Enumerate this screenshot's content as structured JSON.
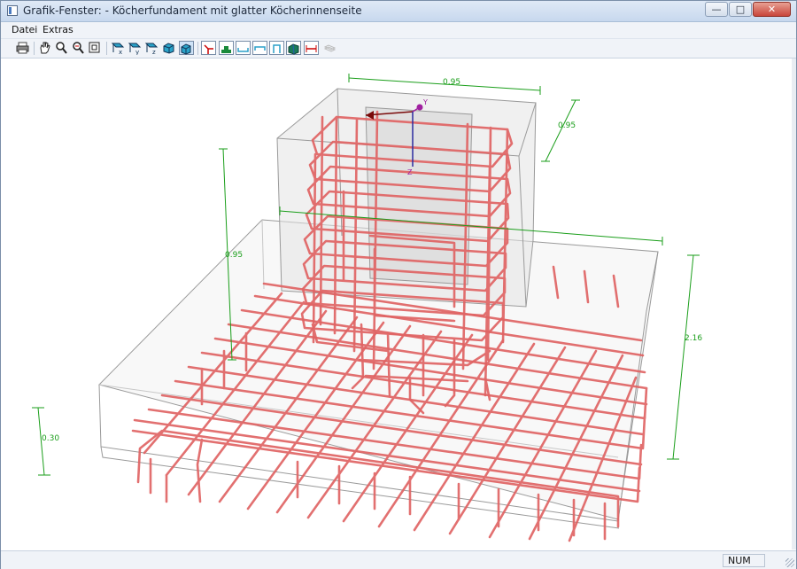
{
  "window": {
    "title": "Grafik-Fenster:  - Köcherfundament mit glatter Köcherinnenseite",
    "controls": {
      "minimize": "—",
      "maximize": "□",
      "close": "✕"
    }
  },
  "menu": [
    "Datei",
    "Extras"
  ],
  "toolbar": {
    "buttons": [
      "print-icon",
      "pan-hand-icon",
      "zoom-icon",
      "zoom-window-icon",
      "zoom-all-icon",
      "view-x-icon",
      "view-y-icon",
      "view-z-icon",
      "isometric-view-icon",
      "render-view-icon",
      "show-axes-icon",
      "show-foundation-icon",
      "show-stirrups-icon",
      "show-bent-bars-icon",
      "show-sleeve-icon",
      "show-solid-icon",
      "show-dimensions-icon",
      "show-hidden-icon"
    ]
  },
  "model": {
    "dimensions": {
      "sleeve_width": "0.95",
      "sleeve_depth": "0.95",
      "sleeve_height": "0.95",
      "footing_length": "2.16",
      "footing_thickness": "0.30"
    },
    "axes": {
      "y": "Y",
      "z": "Z"
    },
    "colors": {
      "rebar": "#e06464",
      "dimension": "#1a9e1a",
      "concrete_edge": "#9a9a9a",
      "axis": "#a020a0"
    }
  },
  "status": {
    "num_indicator": "NUM"
  }
}
